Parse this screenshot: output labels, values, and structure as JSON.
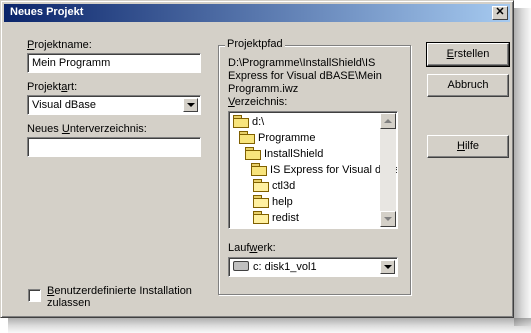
{
  "window": {
    "title": "Neues Projekt",
    "close_glyph": "✕"
  },
  "left": {
    "project_name": {
      "label_pre": "",
      "label_key": "P",
      "label_post": "rojektname:",
      "value": "Mein Programm"
    },
    "project_type": {
      "label_pre": "Projekt",
      "label_key": "a",
      "label_post": "rt:",
      "value": "Visual dBase"
    },
    "subdir": {
      "label_pre": "Neues ",
      "label_key": "U",
      "label_post": "nterverzeichnis:",
      "value": ""
    },
    "custom_install": {
      "label_pre": "",
      "label_key": "B",
      "label_post": "enutzerdefinierte Installation",
      "label_line2": "zulassen",
      "checked": false
    }
  },
  "path_group": {
    "title": "Projektpfad",
    "path_lines": [
      "D:\\Programme\\InstallShield\\IS",
      "Express for Visual dBASE\\Mein",
      "Programm.iwz"
    ],
    "dir_label": {
      "pre": "",
      "key": "V",
      "post": "erzeichnis:"
    },
    "tree": [
      {
        "label": "d:\\",
        "open": true
      },
      {
        "label": "Programme",
        "open": true
      },
      {
        "label": "InstallShield",
        "open": true
      },
      {
        "label": "IS Express for Visual dBase",
        "open": true
      },
      {
        "label": "ctl3d",
        "open": false
      },
      {
        "label": "help",
        "open": false
      },
      {
        "label": "redist",
        "open": false
      }
    ],
    "drive_label": {
      "pre": "Lauf",
      "key": "w",
      "post": "erk:"
    },
    "drive_value": "c: disk1_vol1"
  },
  "buttons": {
    "create": {
      "pre": "",
      "key": "E",
      "post": "rstellen"
    },
    "cancel": "Abbruch",
    "help": {
      "pre": "",
      "key": "H",
      "post": "ilfe"
    }
  },
  "icons": {
    "folder": "folder-icon",
    "drive": "drive-icon"
  }
}
